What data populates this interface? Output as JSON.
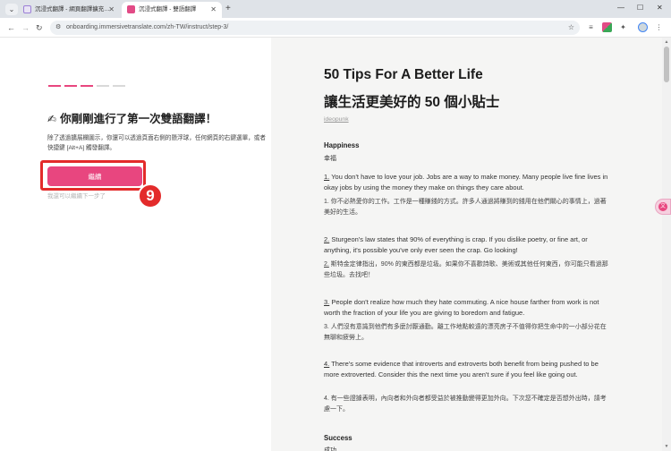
{
  "browser": {
    "tabs": [
      {
        "title": "沉浸式翻譯 - 網頁翻譯擴充 | PDF翻譯",
        "active": false
      },
      {
        "title": "沉浸式翻譯 - 雙語翻譯",
        "active": true
      }
    ],
    "new_tab": "+",
    "url": "onboarding.immersivetranslate.com/zh-TW/instruct/step-3/",
    "window_controls": {
      "minimize": "—",
      "maximize": "☐",
      "close": "✕"
    }
  },
  "onboarding": {
    "progress_steps": [
      {
        "active": true
      },
      {
        "active": true
      },
      {
        "active": true
      },
      {
        "active": false
      },
      {
        "active": false
      }
    ],
    "heading": "你剛剛進行了第一次雙語翻譯！",
    "description": "除了透過擴展欄圖示，你還可以透過頁面右側的懸浮球，任何網頁的右鍵選單，或者快捷鍵 [Alt+A] 觸發翻譯。",
    "continue_label": "繼續",
    "back_link": "我還可以繼續下一步了",
    "step_number": "9",
    "colors": {
      "accent": "#e8467f",
      "highlight": "#e32b2b",
      "progress_inactive": "#d9d9d9"
    }
  },
  "article": {
    "title": "50 Tips For A Better Life",
    "title_zh": "讓生活更美好的 50 個小貼士",
    "author": "ideopunk",
    "sections": [
      {
        "name": "Happiness",
        "name_zh": "幸福"
      },
      {
        "name": "Success",
        "name_zh": "成功"
      }
    ],
    "items": [
      {
        "num": "1.",
        "en": "You don't have to love your job. Jobs are a way to make money. Many people live fine lives in okay jobs by using the money they make on things they care about.",
        "zh": "你不必熱愛你的工作。工作是一種賺錢的方式。許多人通過將賺到的錢用在他們關心的事情上，過著美好的生活。"
      },
      {
        "num": "2.",
        "en": "Sturgeon's law states that 90% of everything is crap. If you dislike poetry, or fine art, or anything, it's possible you've only ever seen the crap. Go looking!",
        "zh": "斯特金定律指出，90% 的東西都是垃圾。如果你不喜歡詩歌、美術或其他任何東西，你可能只看過那些垃圾。去找吧！"
      },
      {
        "num": "3.",
        "en": "People don't realize how much they hate commuting. A nice house farther from work is not worth the fraction of your life you are giving to boredom and fatigue.",
        "zh": "人們沒有意識到他們有多麼討厭通勤。離工作地點較遠的漂亮房子不值得你把生命中的一小部分花在無聊和疲勞上。"
      },
      {
        "num": "4.",
        "en": "There's some evidence that introverts and extroverts both benefit from being pushed to be more extroverted. Consider this the next time you aren't sure if you feel like going out.",
        "zh": "有一些證據表明，內向者和外向者都受益於被推動變得更加外向。下次您不確定是否想外出時，請考慮一下。"
      }
    ]
  },
  "icons": {
    "heading_icon": "✍",
    "float_ball": "文"
  }
}
